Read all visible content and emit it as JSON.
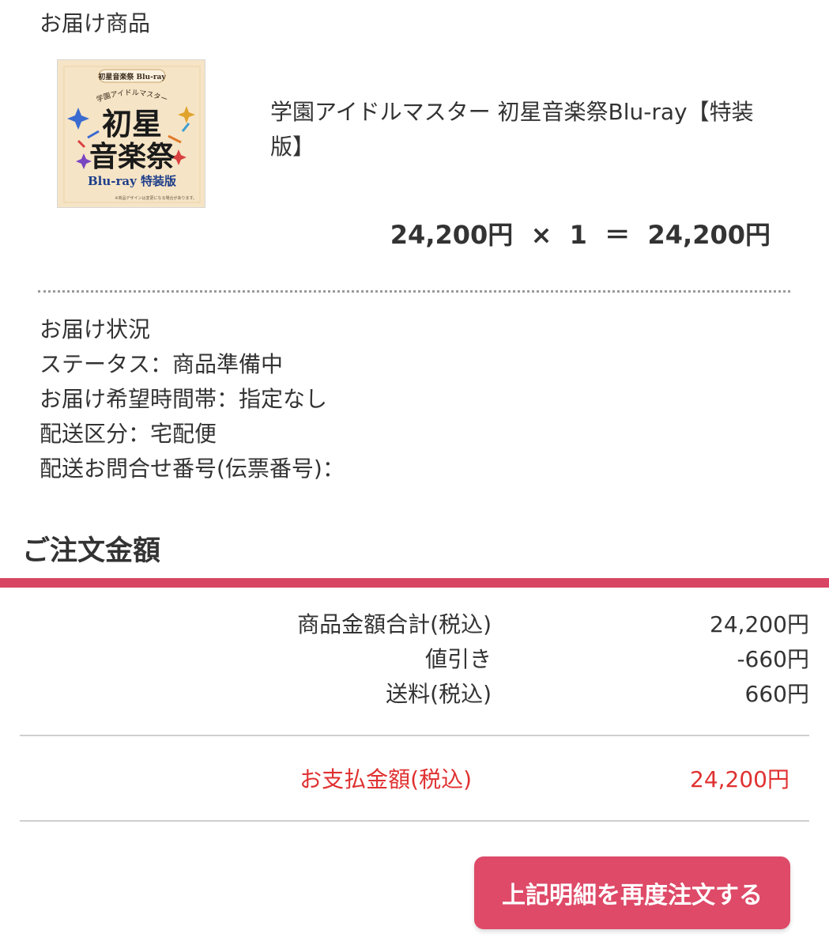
{
  "delivery_item": {
    "section_title": "お届け商品",
    "product_name": "学園アイドルマスター 初星音楽祭Blu-ray【特装版】",
    "unit_price": "24,200円",
    "times_sign": "×",
    "quantity": "1",
    "equals_sign": "＝",
    "line_total": "24,200円",
    "thumbnail": {
      "top_caption": "初星音楽祭 Blu-ray",
      "arc_text": "学園アイドルマスター",
      "main_title_line1": "初星",
      "main_title_line2": "音楽祭",
      "edition": "Blu-ray 特装版",
      "note": "※商品デザインは変更になる場合があります。"
    }
  },
  "delivery_status": {
    "title": "お届け状況",
    "status_line": "ステータス：商品準備中",
    "time_slot_line": "お届け希望時間帯：指定なし",
    "shipping_type_line": "配送区分：宅配便",
    "tracking_line": "配送お問合せ番号(伝票番号)："
  },
  "order_amount": {
    "heading": "ご注文金額",
    "rows": [
      {
        "label": "商品金額合計(税込)",
        "value": "24,200円"
      },
      {
        "label": "値引き",
        "value": "-660円"
      },
      {
        "label": "送料(税込)",
        "value": "660円"
      }
    ],
    "payment_label": "お支払金額(税込)",
    "payment_value": "24,200円"
  },
  "actions": {
    "reorder_label": "上記明細を再度注文する"
  },
  "colors": {
    "accent": "#de4a68",
    "heading_bar": "#d84563",
    "payment_text": "#e03131"
  }
}
